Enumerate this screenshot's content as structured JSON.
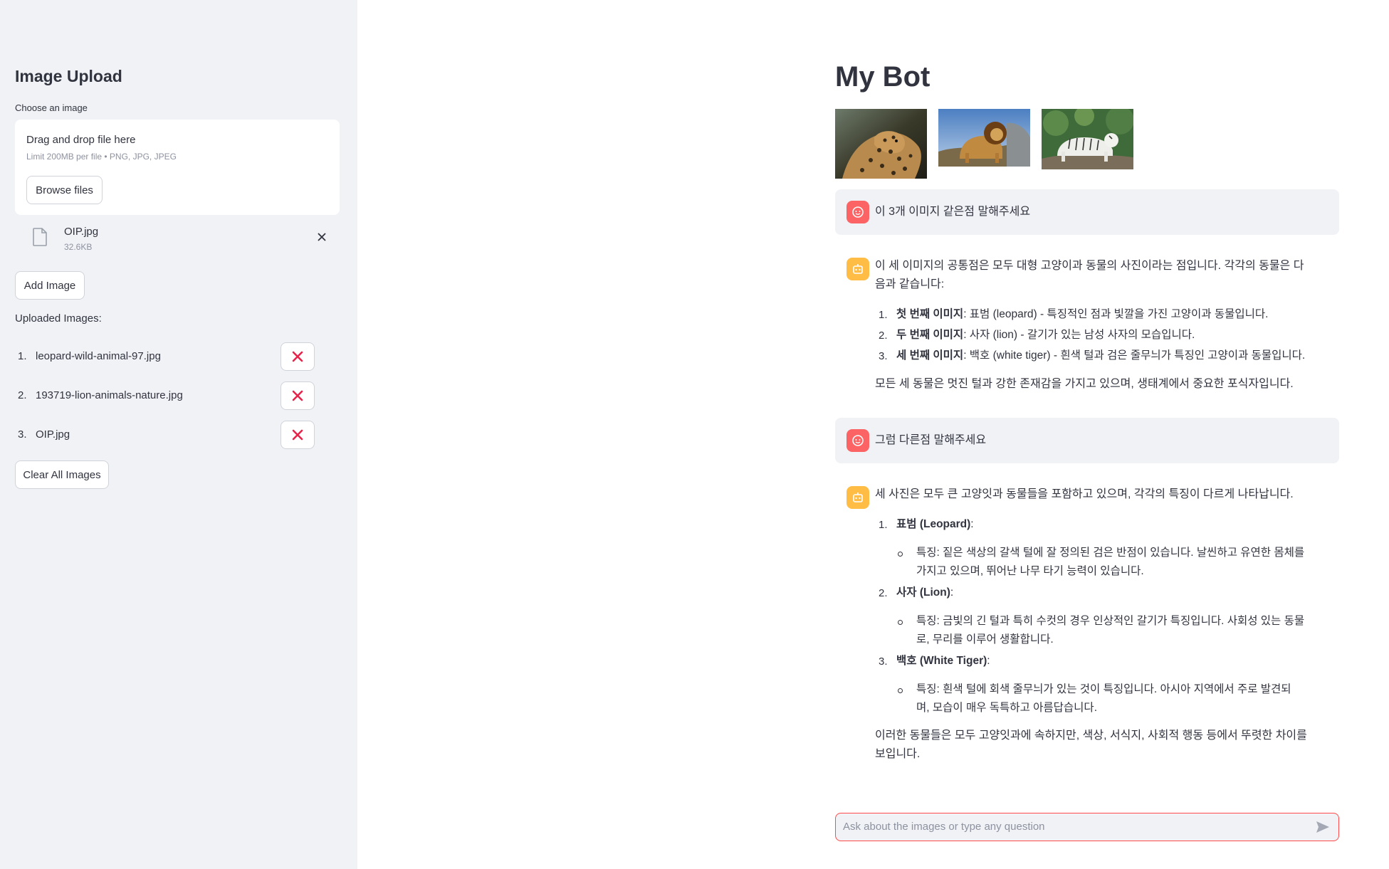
{
  "sidebar": {
    "title": "Image Upload",
    "choose_label": "Choose an image",
    "dropzone": {
      "main": "Drag and drop file here",
      "sub": "Limit 200MB per file • PNG, JPG, JPEG",
      "browse_label": "Browse files"
    },
    "selected_file": {
      "name": "OIP.jpg",
      "size": "32.6KB"
    },
    "add_label": "Add Image",
    "uploaded_label": "Uploaded Images:",
    "uploaded": [
      {
        "num": "1.",
        "name": "leopard-wild-animal-97.jpg"
      },
      {
        "num": "2.",
        "name": "193719-lion-animals-nature.jpg"
      },
      {
        "num": "3.",
        "name": "OIP.jpg"
      }
    ],
    "clear_label": "Clear All Images"
  },
  "main": {
    "title": "My Bot",
    "messages": {
      "u1": "이 3개 이미지 같은점 말해주세요",
      "b1": {
        "intro1": "이 세 이미지의 공통점은 모두 대형 고양이과 동물의 사진이라는 점입니다. 각각의 동물은 다",
        "intro2": "음과 같습니다:",
        "items": [
          {
            "num": "1.",
            "bold": "첫 번째 이미지",
            "rest": ": 표범 (leopard) - 특징적인 점과 빛깔을 가진 고양이과 동물입니다."
          },
          {
            "num": "2.",
            "bold": "두 번째 이미지",
            "rest": ": 사자 (lion) - 갈기가 있는 남성 사자의 모습입니다."
          },
          {
            "num": "3.",
            "bold": "세 번째 이미지",
            "rest": ": 백호 (white tiger) - 흰색 털과 검은 줄무늬가 특징인 고양이과 동물입니다."
          }
        ],
        "outro": "모든 세 동물은 멋진 털과 강한 존재감을 가지고 있으며, 생태계에서 중요한 포식자입니다."
      },
      "u2": "그럼 다른점 말해주세요",
      "b2": {
        "intro": "세 사진은 모두 큰 고양잇과 동물들을 포함하고 있으며, 각각의 특징이 다르게 나타납니다.",
        "items": [
          {
            "num": "1.",
            "bold": "표범 (Leopard)",
            "rest": ":",
            "detail1": "특징: 짙은 색상의 갈색 털에 잘 정의된 검은 반점이 있습니다. 날씬하고 유연한 몸체를",
            "detail2": "가지고 있으며, 뛰어난 나무 타기 능력이 있습니다."
          },
          {
            "num": "2.",
            "bold": "사자 (Lion)",
            "rest": ":",
            "detail1": "특징: 금빛의 긴 털과 특히 수컷의 경우 인상적인 갈기가 특징입니다. 사회성 있는 동물",
            "detail2": "로, 무리를 이루어 생활합니다."
          },
          {
            "num": "3.",
            "bold": "백호 (White Tiger)",
            "rest": ":",
            "detail1": "특징: 흰색 털에 회색 줄무늬가 있는 것이 특징입니다. 아시아 지역에서 주로 발견되",
            "detail2": "며, 모습이 매우 독특하고 아름답습니다."
          }
        ],
        "outro1": "이러한 동물들은 모두 고양잇과에 속하지만, 색상, 서식지, 사회적 행동 등에서 뚜렷한 차이를",
        "outro2": "보입니다."
      }
    },
    "chat_input": {
      "placeholder": "Ask about the images or type any question"
    }
  },
  "colors": {
    "accent": "#ff4b4b",
    "bot_avatar": "#ffbd45",
    "sidebar_bg": "#f0f2f6"
  }
}
